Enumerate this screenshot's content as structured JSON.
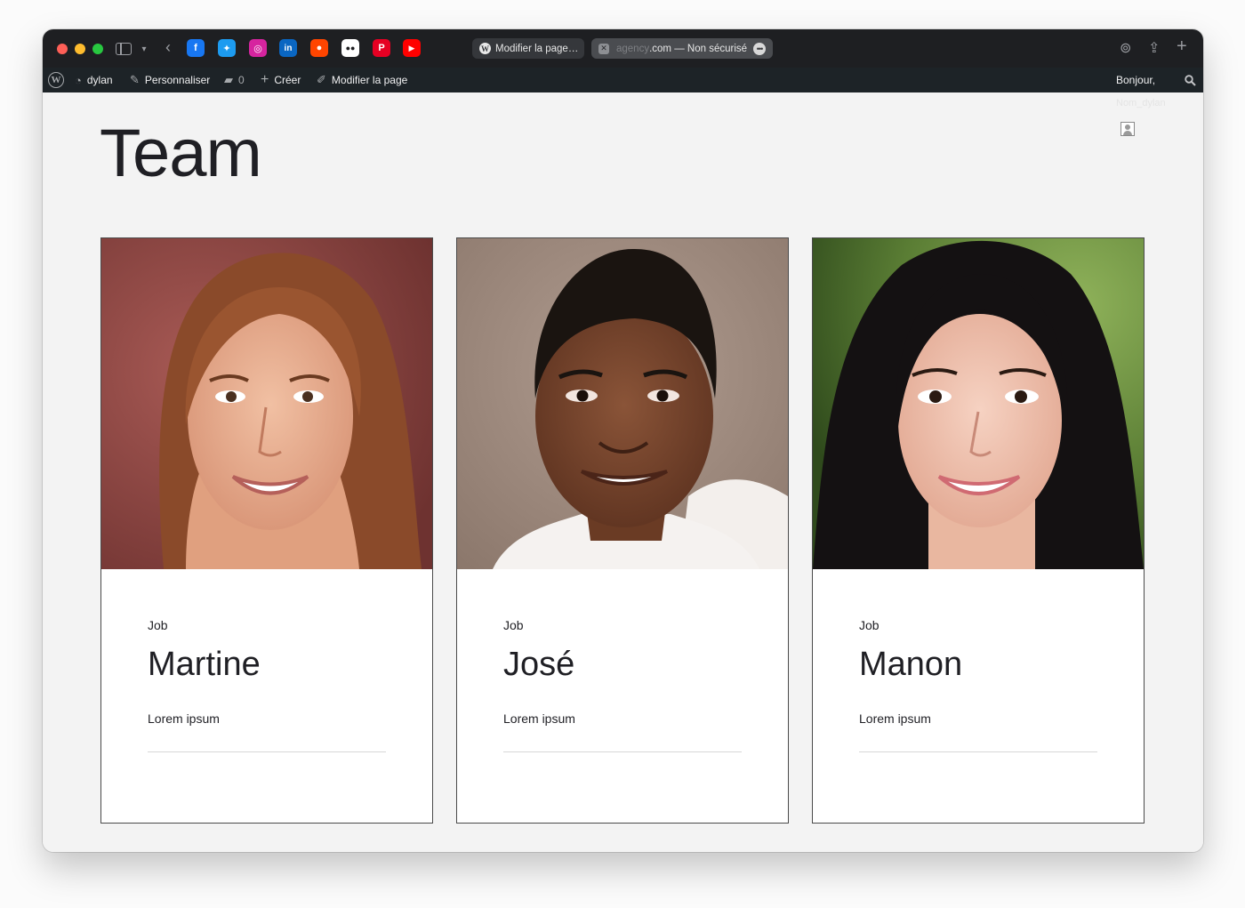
{
  "browser": {
    "tabs": [
      {
        "label": "Modifier la page…"
      },
      {
        "label_fade": "agency",
        "label": ".com — Non sécurisé"
      }
    ],
    "bookmarks": [
      {
        "icon": "facebook-icon",
        "glyph": "f",
        "color": "#1877f2"
      },
      {
        "icon": "twitter-icon",
        "glyph": "t",
        "color": "#1d9bf0"
      },
      {
        "icon": "instagram-icon",
        "glyph": "◎",
        "color": "#d6249f"
      },
      {
        "icon": "linkedin-icon",
        "glyph": "in",
        "color": "#0a66c2"
      },
      {
        "icon": "reddit-icon",
        "glyph": "●",
        "color": "#ff4500"
      },
      {
        "icon": "flickr-icon",
        "glyph": "••",
        "color": "#2b2d31"
      },
      {
        "icon": "pinterest-icon",
        "glyph": "P",
        "color": "#e60023"
      },
      {
        "icon": "youtube-icon",
        "glyph": "▶",
        "color": "#ff0000"
      }
    ]
  },
  "adminbar": {
    "site": "dylan",
    "customize": "Personnaliser",
    "comments_count": "0",
    "create": "Créer",
    "edit_page": "Modifier la page",
    "greeting": "Bonjour,",
    "username_ghost": "Nom_dylan"
  },
  "page": {
    "title": "Team"
  },
  "team": [
    {
      "job": "Job",
      "name": "Martine",
      "desc": "Lorem ipsum"
    },
    {
      "job": "Job",
      "name": "José",
      "desc": "Lorem ipsum"
    },
    {
      "job": "Job",
      "name": "Manon",
      "desc": "Lorem ipsum"
    }
  ]
}
